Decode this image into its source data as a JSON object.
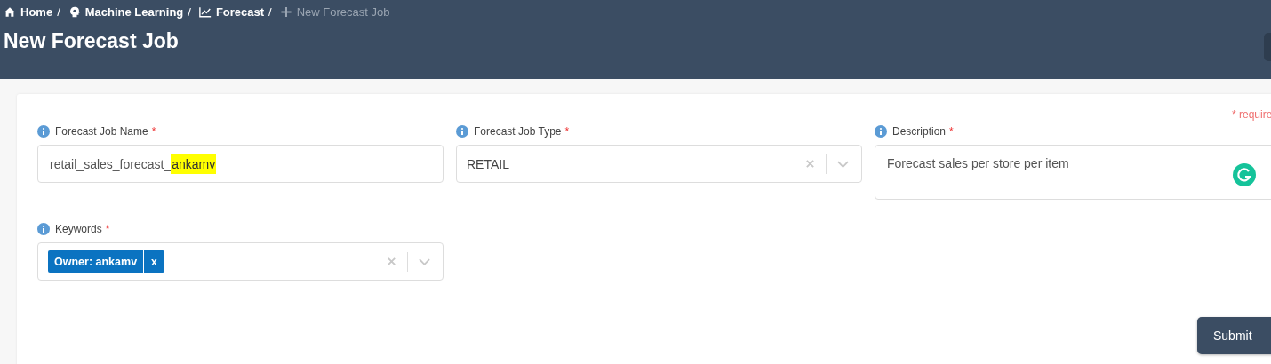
{
  "breadcrumbs": [
    {
      "label": "Home",
      "separator": "/",
      "current": false
    },
    {
      "label": "Machine Learning",
      "separator": "/",
      "current": false
    },
    {
      "label": "Forecast",
      "separator": "/",
      "current": false
    },
    {
      "label": "New Forecast Job",
      "current": true
    }
  ],
  "page_title": "New Forecast Job",
  "required_note": "* require",
  "fields": [
    {
      "kind": "text",
      "label": "Forecast Job Name",
      "required_mark": "*",
      "value_parts": [
        {
          "text": "retail_sales_forecast_",
          "highlighted": false
        },
        {
          "text": "ankamv",
          "highlighted": true
        }
      ]
    },
    {
      "kind": "select",
      "label": "Forecast Job Type",
      "required_mark": "*",
      "value": "RETAIL"
    },
    {
      "kind": "textarea",
      "label": "Description",
      "required_mark": "*",
      "value": "Forecast sales per store per item"
    },
    {
      "kind": "tags",
      "label": "Keywords",
      "required_mark": "*",
      "tags": [
        {
          "label": "Owner: ankamv",
          "remove": "x"
        }
      ]
    }
  ],
  "submit": "Submit"
}
